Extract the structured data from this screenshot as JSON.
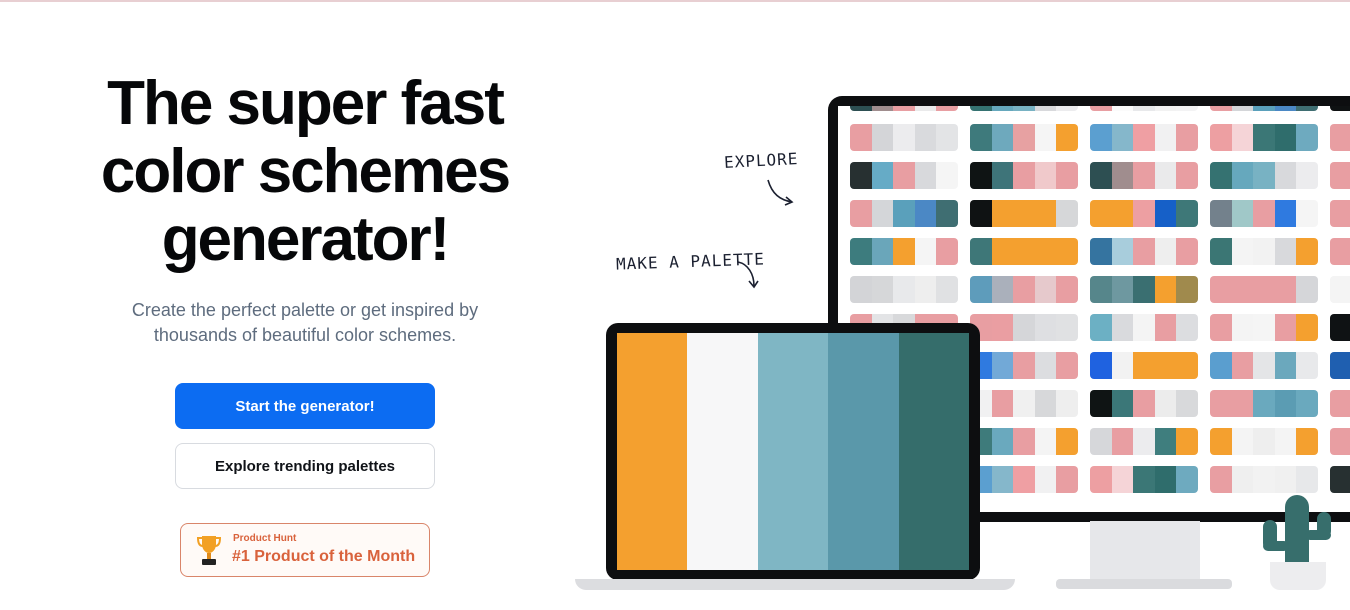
{
  "hero": {
    "title_lines": [
      "The super fast",
      "color schemes",
      "generator!"
    ],
    "subtitle_lines": [
      "Create the perfect palette or get inspired by",
      "thousands of beautiful color schemes."
    ]
  },
  "actions": {
    "primary_label": "Start the generator!",
    "secondary_label": "Explore trending palettes"
  },
  "product_hunt": {
    "eyebrow": "Product Hunt",
    "text": "#1 Product of the Month",
    "icon": "trophy-icon"
  },
  "annotations": {
    "explore": "EXPLORE",
    "make_palette": "MAKE A PALETTE"
  },
  "colors": {
    "primary_button": "#0c6cf2",
    "badge_accent": "#d9623c",
    "orange": "#f4a02f",
    "white": "#f7f7f8",
    "light_blue": "#76b4c6",
    "steel_blue": "#5798aa",
    "teal": "#356d6b"
  },
  "laptop_palette": [
    "#f4a02f",
    "#f7f7f8",
    "#7fb6c4",
    "#5a98aa",
    "#356d6b"
  ],
  "monitor_palettes": [
    [
      "#e89ea2",
      "#d4d5d8",
      "#ececee",
      "#d9dadd",
      "#e3e4e6"
    ],
    [
      "#3e7a7c",
      "#6ea9bd",
      "#e7a1a2",
      "#f5f5f5",
      "#f4a02f"
    ],
    [
      "#5b9fd0",
      "#85b7cb",
      "#ef9fa3",
      "#f1f1f2",
      "#e89ea2"
    ],
    [
      "#ed9fa2",
      "#f5d4d7",
      "#3b7776",
      "#2f6d6c",
      "#6eaabf"
    ],
    [
      "#e89ea2",
      "#efefef",
      "#f2f2f2",
      "#f0f0f0",
      "#e7e8ea"
    ],
    [
      "#273031",
      "#66abc6",
      "#e89ea2",
      "#d8d9dc",
      "#f5f5f5"
    ],
    [
      "#0f1414",
      "#3e7479",
      "#e89ea2",
      "#f0c9cb",
      "#e89ea2"
    ],
    [
      "#2d4f52",
      "#a08d8e",
      "#e89ea2",
      "#eaeaeb",
      "#e89ea2"
    ],
    [
      "#357271",
      "#66a8bd",
      "#78b2c3",
      "#d8d9dc",
      "#ececee"
    ],
    [
      "#e89ea2",
      "#fbfbfb",
      "#e8e9eb",
      "#f2f2f2",
      "#f3f3f4"
    ],
    [
      "#e89ea2",
      "#d4d6d9",
      "#5aa0bb",
      "#4b88c5",
      "#3f6e72"
    ],
    [
      "#0f1213",
      "#f4a02f",
      "#f4a02f",
      "#f4a02f",
      "#d6d7d9"
    ],
    [
      "#f4a02f",
      "#f4a02f",
      "#ed9fa2",
      "#1660c8",
      "#3e7878"
    ],
    [
      "#73818c",
      "#a0c8c8",
      "#e89ea2",
      "#2f7ae0",
      "#f5f5f5"
    ],
    [
      "#e89ea2",
      "#f4f4f5",
      "#2f6f7c",
      "#e89ea2",
      "#f1f1f2"
    ],
    [
      "#3d7c7e",
      "#6aa6ba",
      "#f4a02f",
      "#f5f5f5",
      "#e89ea2"
    ],
    [
      "#3e7778",
      "#f4a02f",
      "#f4a02f",
      "#f4a02f",
      "#f4a02f"
    ],
    [
      "#3574a0",
      "#a8cddc",
      "#e89ea2",
      "#eeeeee",
      "#e89ea2"
    ],
    [
      "#3b7674",
      "#f4f4f4",
      "#f2f2f2",
      "#d8d9dc",
      "#f4a02f"
    ],
    [
      "#e89ea2",
      "#eeeeee",
      "#f4f4f4",
      "#f2f2f2",
      "#eeeeee"
    ],
    [
      "#d3d4d7",
      "#d6d7d9",
      "#e8e9eb",
      "#eeeeee",
      "#e0e1e3"
    ],
    [
      "#5e9cbb",
      "#aab0bb",
      "#e89ea2",
      "#e6c9cc",
      "#e89ea2"
    ],
    [
      "#56868b",
      "#6e98a0",
      "#3a6f71",
      "#f4a02f",
      "#a08a4d"
    ],
    [
      "#e89ea2",
      "#e89ea2",
      "#e89ea2",
      "#e89ea2",
      "#d5d6d9"
    ],
    [
      "#f4f4f4",
      "#eeeeee",
      "#e5e6e8",
      "#ececec",
      "#e89ea2"
    ],
    [
      "#e89ea2",
      "#e3e4e6",
      "#d8d9db",
      "#e89ea2",
      "#e89ea2"
    ],
    [
      "#e89ea2",
      "#ea9ea2",
      "#d5d6d9",
      "#dedfe2",
      "#e0e1e3"
    ],
    [
      "#6cb0c4",
      "#d9dadd",
      "#f4f4f4",
      "#e89ea2",
      "#dcdde0"
    ],
    [
      "#e89ea2",
      "#f4f4f4",
      "#f5f5f5",
      "#e89ea2",
      "#f4a02f"
    ],
    [
      "#0f1214",
      "#1a63e0",
      "#f4a02f",
      "#f4a02f",
      "#6ea9bd"
    ],
    [
      "#3a7576",
      "#6ca8bc",
      "#f4a02f",
      "#f4a02f",
      "#f4a02f"
    ],
    [
      "#2f7ae0",
      "#72a9d7",
      "#e89ea2",
      "#dcdde0",
      "#e89ea2"
    ],
    [
      "#1f62e0",
      "#f2f2f2",
      "#f4a02f",
      "#f4a02f",
      "#f4a02f"
    ],
    [
      "#5a9ecf",
      "#e89ea2",
      "#e4e5e7",
      "#6ba8bd",
      "#e8e9eb"
    ],
    [
      "#1f5fb0",
      "#5d9fd2",
      "#d5d6d9",
      "#e89ea2",
      "#e89ea2"
    ],
    [
      "#e89ea2",
      "#f3f3f3",
      "#e1e2e4",
      "#f0f0f0",
      "#ececec"
    ],
    [
      "#f1f1f2",
      "#e89ea2",
      "#f0f0f0",
      "#d7d8da",
      "#eeeeee"
    ],
    [
      "#0f1414",
      "#3b7778",
      "#e89ea2",
      "#ececec",
      "#d8d9db"
    ],
    [
      "#e89ea2",
      "#e89ea2",
      "#6aa9be",
      "#5b9cb3",
      "#6aa9be"
    ],
    [
      "#e89ea2",
      "#f5f5f5",
      "#f4a02f",
      "#f4a02f",
      "#f1f1f1"
    ],
    [
      "#5e9bcf",
      "#73aac6",
      "#e89ea2",
      "#f2f2f2",
      "#f4a02f"
    ],
    [
      "#3e7b7b",
      "#6aa9be",
      "#e89ea2",
      "#f4f4f4",
      "#f4a02f"
    ],
    [
      "#d6d7da",
      "#e89ea2",
      "#ececee",
      "#3f7e7e",
      "#f4a02f"
    ],
    [
      "#f4a02f",
      "#f4f4f4",
      "#eeeeee",
      "#f4f4f4",
      "#f4a02f"
    ]
  ]
}
